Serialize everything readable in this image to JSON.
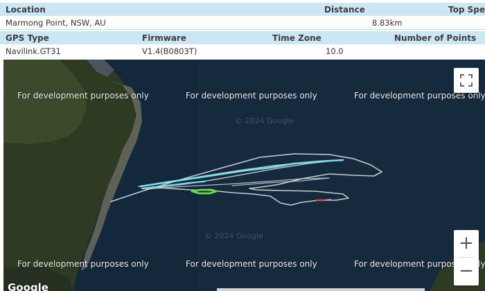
{
  "info": {
    "headers1": {
      "location": "Location",
      "distance": "Distance",
      "top_speed": "Top Speed"
    },
    "values1": {
      "location": "Marmong Point, NSW, AU",
      "distance": "8.83km"
    },
    "headers2": {
      "gps_type": "GPS Type",
      "firmware": "Firmware",
      "time_zone": "Time Zone",
      "num_points": "Number of Points"
    },
    "values2": {
      "gps_type": "Navilink.GT31",
      "firmware": "V1.4(B0803T)",
      "time_zone": "10.0"
    }
  },
  "map": {
    "watermark": "For development purposes only",
    "faint_copyright": "© 2024 Google",
    "google_logo": "Google",
    "fullscreen_icon": "fullscreen-icon",
    "zoom_in": "+",
    "zoom_out": "−"
  },
  "colors": {
    "header_bg": "#cde6f5",
    "water": "#14283b",
    "track_main": "#d8dde2",
    "track_fast": "#7fe0ea",
    "track_green": "#6ad84a",
    "track_red": "#e84040"
  }
}
